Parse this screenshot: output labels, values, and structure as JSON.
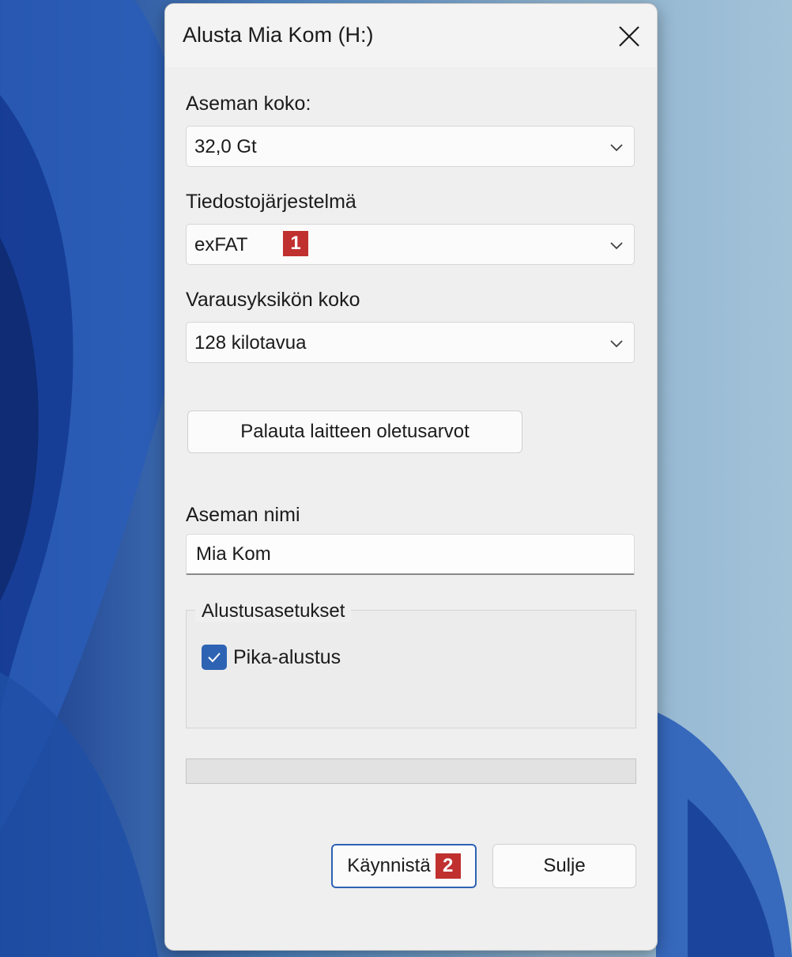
{
  "dialog": {
    "title": "Alusta Mia Kom (H:)",
    "capacity": {
      "label": "Aseman koko:",
      "value": "32,0 Gt"
    },
    "filesystem": {
      "label": "Tiedostojärjestelmä",
      "value": "exFAT",
      "annotation": "1"
    },
    "allocation": {
      "label": "Varausyksikön koko",
      "value": "128 kilotavua"
    },
    "restore_defaults_label": "Palauta laitteen oletusarvot",
    "volume": {
      "label": "Aseman nimi",
      "value": "Mia Kom"
    },
    "options": {
      "legend": "Alustusasetukset",
      "quick_format": {
        "label": "Pika-alustus",
        "checked": true
      }
    },
    "progress_fraction": 0,
    "start_label": "Käynnistä",
    "start_annotation": "2",
    "close_label": "Sulje"
  },
  "colors": {
    "accent": "#2e63b4",
    "annotation_badge": "#c0302f",
    "dialog_background": "#efefef"
  }
}
